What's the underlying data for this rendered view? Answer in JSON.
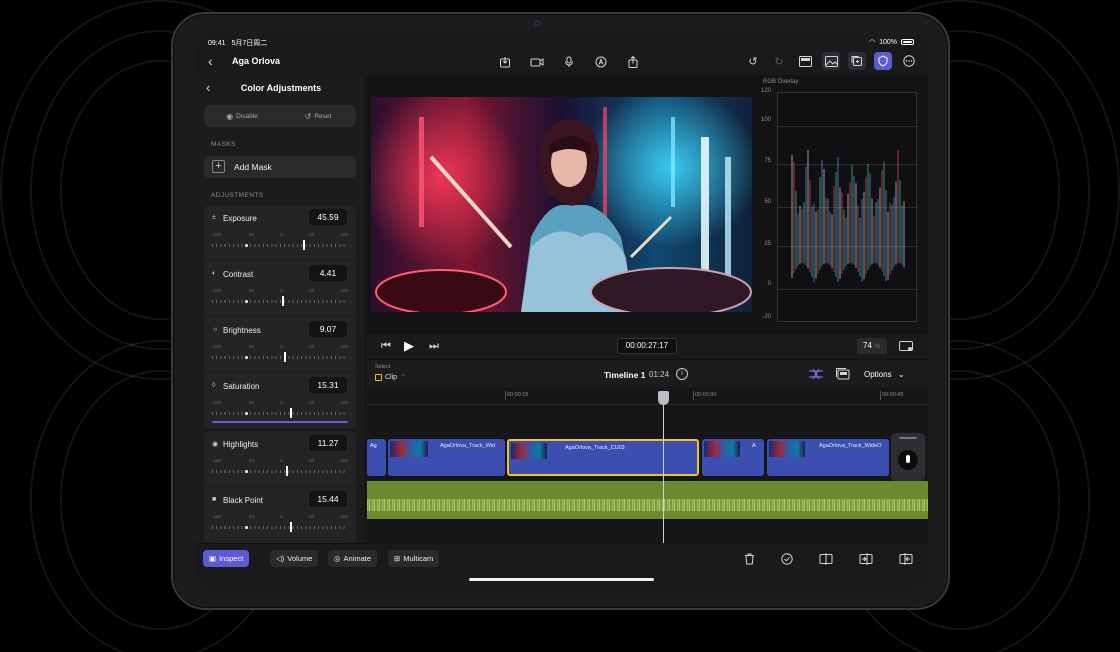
{
  "status": {
    "time": "09:41",
    "date": "5月7日周二",
    "battery": "100%"
  },
  "nav": {
    "back_icon": "chevron-left-icon",
    "project_title": "Aga Orlova"
  },
  "inspector": {
    "title": "Color Adjustments",
    "disable_label": "Disable",
    "reset_label": "Reset",
    "masks_heading": "MASKS",
    "add_mask_label": "Add Mask",
    "adjustments_heading": "ADJUSTMENTS",
    "adjustments": [
      {
        "label": "Exposure",
        "value": "45.59",
        "scale": [
          "-100",
          "-50",
          "0",
          "50",
          "100"
        ],
        "level": 0.68
      },
      {
        "label": "Contrast",
        "value": "4.41",
        "scale": [
          "-100",
          "-50",
          "0",
          "50",
          "100"
        ],
        "level": 0.52
      },
      {
        "label": "Brightness",
        "value": "9.07",
        "scale": [
          "-100",
          "-50",
          "0",
          "50",
          "100"
        ],
        "level": 0.54
      },
      {
        "label": "Saturation",
        "value": "15.31",
        "scale": [
          "-100",
          "-50",
          "0",
          "50",
          "100"
        ],
        "level": 0.58
      },
      {
        "label": "Highlights",
        "value": "11.27",
        "scale": [
          "-100",
          "-50",
          "0",
          "50",
          "100"
        ],
        "level": 0.55
      },
      {
        "label": "Black Point",
        "value": "15.44",
        "scale": [
          "-100",
          "-50",
          "0",
          "50",
          "100"
        ],
        "level": 0.58
      }
    ]
  },
  "scope": {
    "title": "RGB Overlay",
    "labels": [
      "120",
      "100",
      "75",
      "50",
      "25",
      "0",
      "-20"
    ]
  },
  "transport": {
    "timecode": "00:00:27:17",
    "zoom": "74",
    "zoom_unit": "%"
  },
  "timeline": {
    "select_label": "Select",
    "mode_label": "Clip",
    "name": "Timeline 1",
    "duration": "01:24",
    "options_label": "Options",
    "ruler": [
      "00:00:15",
      "00:00:30",
      "00:00:45"
    ],
    "clips": [
      {
        "title": "Ag"
      },
      {
        "title": "AgaOrlova_Track_Wid"
      },
      {
        "title": "AgaOrlova_Track_CU03"
      },
      {
        "title": "A"
      },
      {
        "title": "AgaOrlova_Track_WideO"
      }
    ]
  },
  "toolbar": {
    "inspect_label": "Inspect",
    "volume_label": "Volume",
    "animate_label": "Animate",
    "multicam_label": "Multicam"
  },
  "colors": {
    "accent": "#5b5bd6",
    "clip_blue": "#3b4fb0",
    "selection_yellow": "#f0c419",
    "audio_green": "#6b8a32"
  }
}
